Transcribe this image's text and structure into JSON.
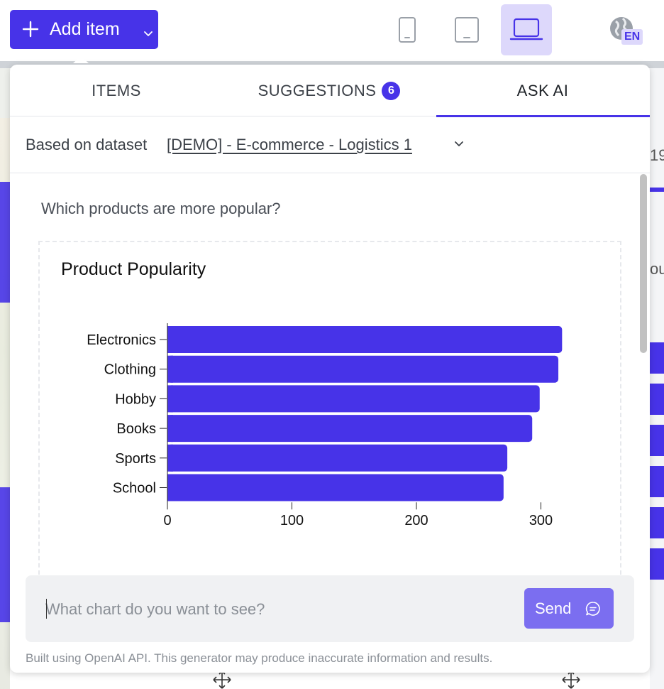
{
  "toolbar": {
    "add_item_label": "Add item",
    "language": "EN"
  },
  "colors": {
    "accent": "#4733e8",
    "accent_light": "#ddd8fb",
    "send": "#7b6ef0"
  },
  "background": {
    "right_text_1": "19",
    "right_text_2": "ou"
  },
  "tabs": [
    {
      "label": "ITEMS"
    },
    {
      "label": "SUGGESTIONS",
      "badge": "6"
    },
    {
      "label": "ASK AI",
      "active": true
    }
  ],
  "dataset": {
    "prefix": "Based on dataset",
    "name": "[DEMO] - E-commerce - Logistics 1"
  },
  "question": "Which products are more popular?",
  "chart_data": {
    "type": "bar",
    "orientation": "horizontal",
    "title": "Product Popularity",
    "categories": [
      "Electronics",
      "Clothing",
      "Hobby",
      "Books",
      "Sports",
      "School"
    ],
    "values": [
      317,
      314,
      299,
      293,
      273,
      270
    ],
    "xticks": [
      "0",
      "100",
      "200",
      "300"
    ],
    "xlim": [
      0,
      300
    ],
    "color": "#4733e8",
    "grid": false
  },
  "chat_input": {
    "placeholder": "What chart do you want to see?",
    "value": ""
  },
  "send_label": "Send",
  "disclaimer": "Built using OpenAI API. This generator may produce inaccurate information and results."
}
